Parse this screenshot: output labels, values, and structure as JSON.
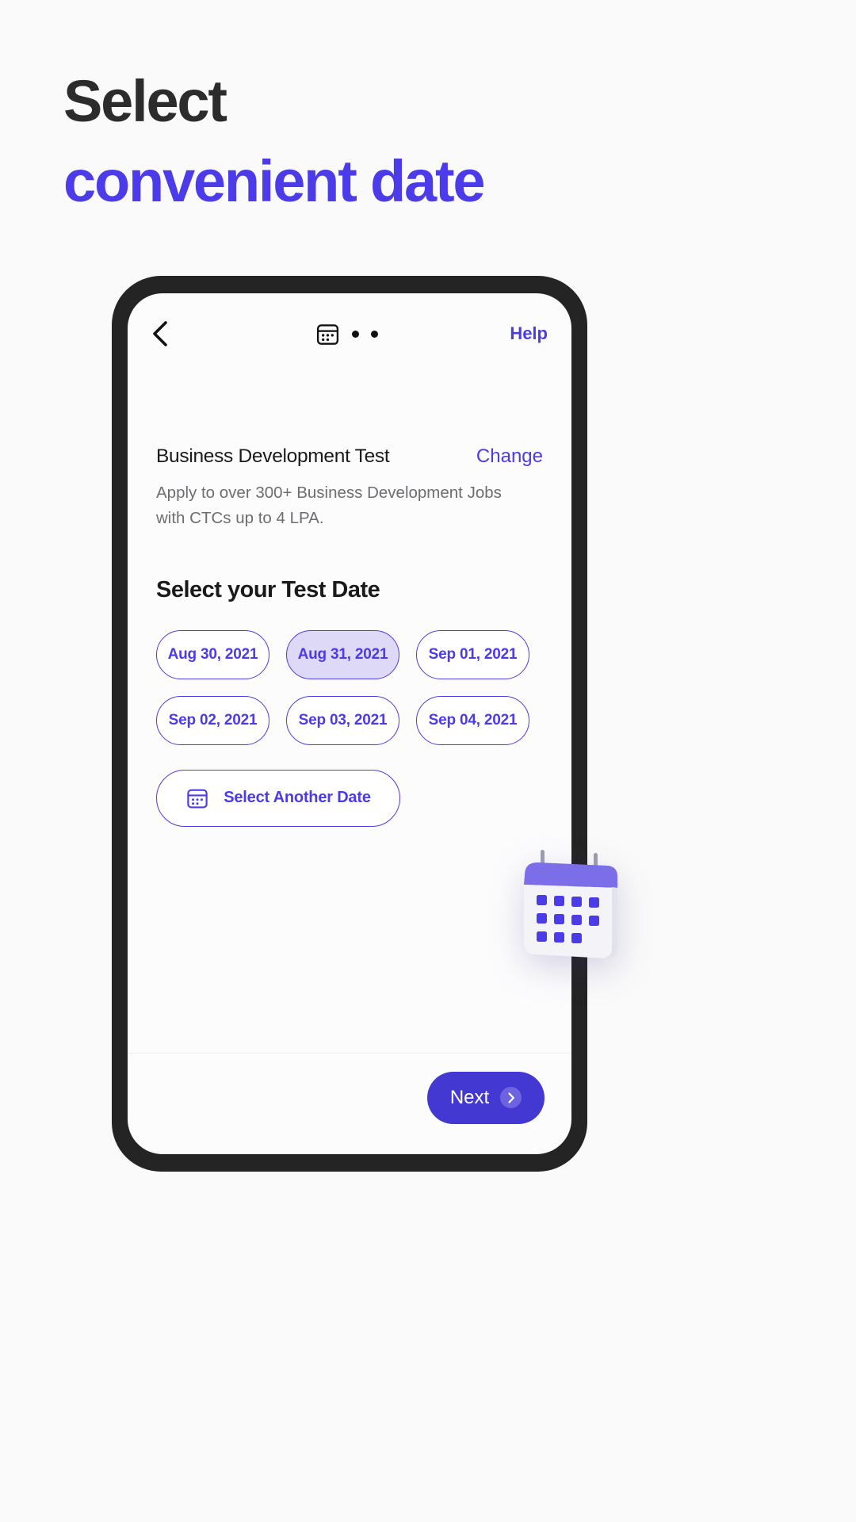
{
  "promo": {
    "line1": "Select",
    "line2": "convenient date",
    "accent_color": "#4B3BE8",
    "dark_color": "#2C2C2C"
  },
  "app": {
    "header": {
      "back_icon": "chevron-left-icon",
      "step_icon": "calendar-icon",
      "step_dots": 2,
      "help_label": "Help"
    },
    "test": {
      "title": "Business Development Test",
      "change_label": "Change",
      "description": "Apply to over 300+ Business Development Jobs with CTCs up to 4 LPA."
    },
    "section_title": "Select your Test Date",
    "dates": [
      {
        "label": "Aug 30, 2021",
        "selected": false
      },
      {
        "label": "Aug 31, 2021",
        "selected": true
      },
      {
        "label": "Sep 01, 2021",
        "selected": false
      },
      {
        "label": "Sep 02, 2021",
        "selected": false
      },
      {
        "label": "Sep 03, 2021",
        "selected": false
      },
      {
        "label": "Sep 04, 2021",
        "selected": false
      }
    ],
    "another_date": {
      "icon": "calendar-icon",
      "label": "Select Another Date"
    },
    "footer": {
      "next_label": "Next",
      "next_icon": "chevron-right-icon"
    }
  },
  "decor": {
    "calendar_illustration": "calendar-3d-illustration",
    "calendar_header_color": "#7B6EE8",
    "calendar_body_color": "#F4F4F8",
    "calendar_dot_color": "#4B3BE8"
  }
}
